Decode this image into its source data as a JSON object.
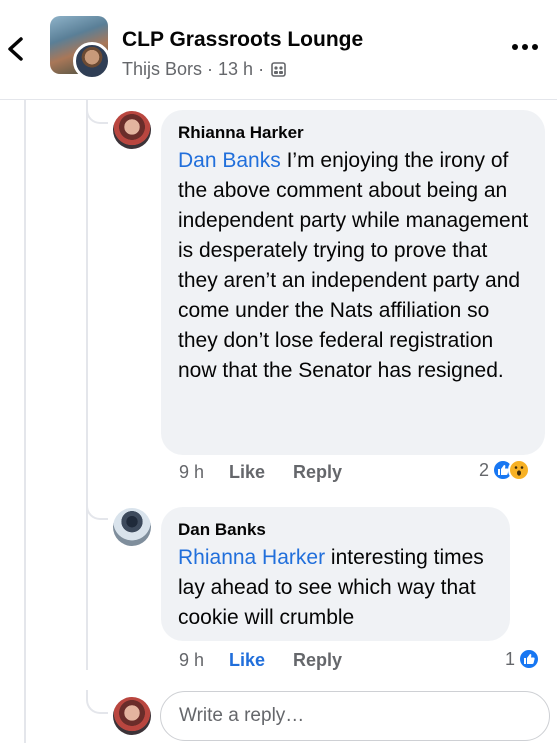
{
  "header": {
    "group_name": "CLP Grassroots Lounge",
    "poster_name": "Thijs Bors",
    "separator": "·",
    "time_ago": "13 h",
    "back_icon": "chevron-left-icon",
    "more_icon": "more-dots-icon",
    "audience_icon": "group-icon"
  },
  "comments": [
    {
      "author": "Rhianna Harker",
      "mention": "Dan Banks",
      "text": " I’m enjoying the irony of the above comment about being an independent party while management is desperately trying to prove that they aren’t an independent party and come under the Nats affiliation so they don’t lose federal registration now that the Senator has resigned.",
      "time": "9 h",
      "like_label": "Like",
      "reply_label": "Reply",
      "reaction_count": "2",
      "reactions": [
        "like",
        "wow"
      ]
    },
    {
      "author": "Dan Banks",
      "mention": "Rhianna Harker",
      "text": " interesting times lay ahead to see which way that cookie will crumble",
      "time": "9 h",
      "like_label": "Like",
      "reply_label": "Reply",
      "reaction_count": "1",
      "reactions": [
        "like"
      ],
      "liked": true
    }
  ],
  "reply_input": {
    "placeholder": "Write a reply…"
  },
  "colors": {
    "link": "#216fdb",
    "bubble": "#f0f2f5",
    "secondary_text": "#65676b",
    "like_blue": "#1877f2",
    "wow_yellow": "#f7b125"
  }
}
